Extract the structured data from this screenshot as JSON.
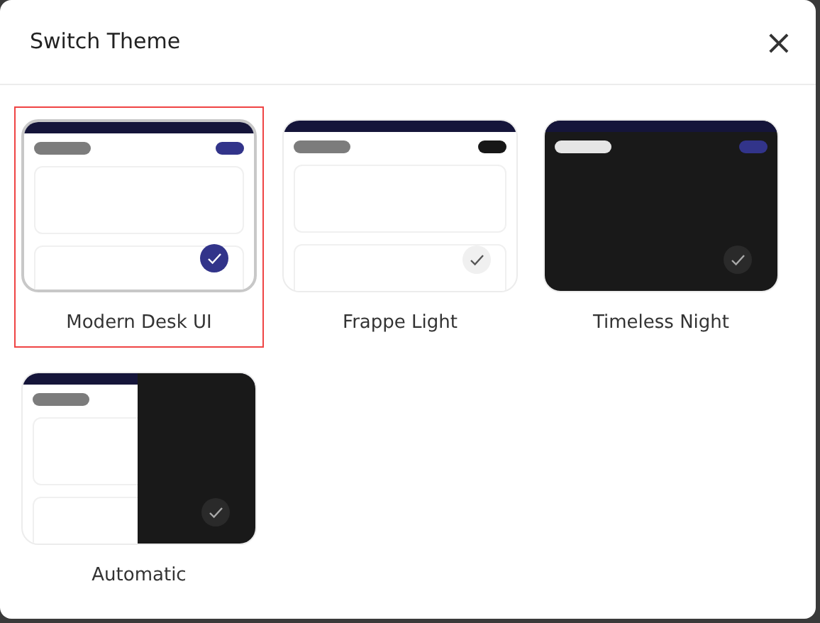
{
  "dialog": {
    "title": "Switch Theme",
    "close": "×"
  },
  "themes": [
    {
      "label": "Modern Desk UI",
      "kind": "modern",
      "selected": true
    },
    {
      "label": "Frappe Light",
      "kind": "light",
      "selected": false
    },
    {
      "label": "Timeless Night",
      "kind": "dark",
      "selected": false
    },
    {
      "label": "Automatic",
      "kind": "auto",
      "selected": false
    }
  ]
}
